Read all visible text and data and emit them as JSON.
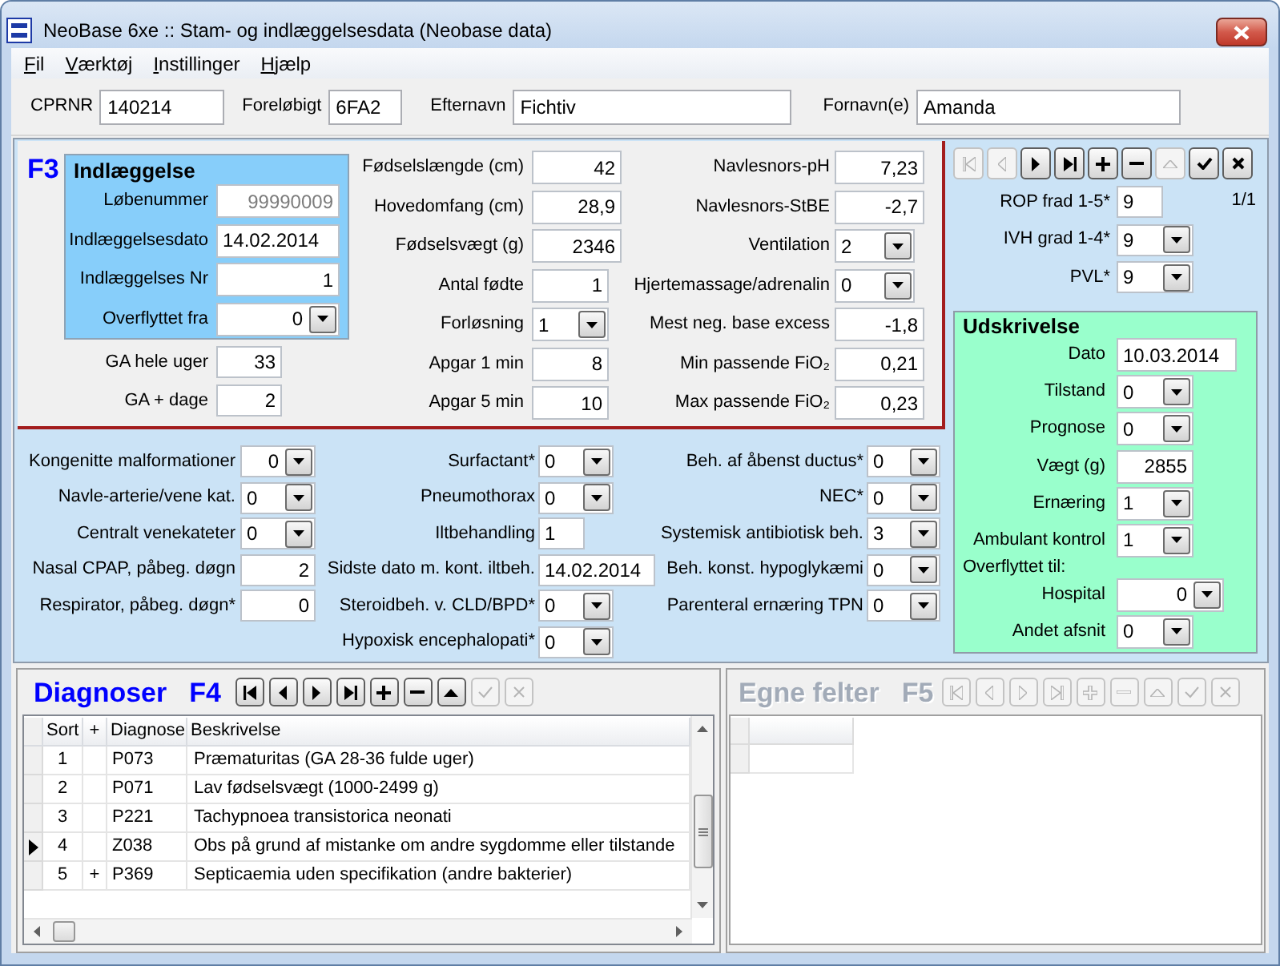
{
  "window": {
    "title": "NeoBase 6xe :: Stam- og indlæggelsesdata (Neobase data)"
  },
  "menu": [
    "Fil",
    "Værktøj",
    "Instillinger",
    "Hjælp"
  ],
  "patient_fields": [
    {
      "label": "CPRNR",
      "value": "140214"
    },
    {
      "label": "Foreløbigt",
      "value": "6FA2"
    },
    {
      "label": "Efternavn",
      "value": "Fichtiv"
    },
    {
      "label": "Fornavn(e)",
      "value": "Amanda"
    }
  ],
  "admission": {
    "hotkey": "F3",
    "indlaeggelse": {
      "title": "Indlæggelse",
      "fields": [
        {
          "label": "Løbenummer",
          "value": "99990009",
          "kind": "number",
          "disabled": true
        },
        {
          "label": "Indlæggelsesdato",
          "value": "14.02.2014",
          "kind": "text",
          "disabled": false
        },
        {
          "label": "Indlæggelses Nr",
          "value": "1",
          "kind": "number",
          "disabled": false
        },
        {
          "label": "Overflyttet fra",
          "value": "0",
          "kind": "lookup",
          "disabled": false
        }
      ]
    },
    "gestation": [
      {
        "label": "GA hele uger",
        "value": "33",
        "kind": "number"
      },
      {
        "label": "GA + dage",
        "value": "2",
        "kind": "number"
      }
    ],
    "birth": [
      {
        "label": "Fødselslængde (cm)",
        "value": "42",
        "kind": "number"
      },
      {
        "label": "Hovedomfang (cm)",
        "value": "28,9",
        "kind": "number"
      },
      {
        "label": "Fødselsvægt (g)",
        "value": "2346",
        "kind": "number"
      },
      {
        "label": "Antal fødte",
        "value": "1",
        "kind": "number"
      },
      {
        "label": "Forløsning",
        "value": "1",
        "kind": "combo"
      },
      {
        "label": "Apgar 1 min",
        "value": "8",
        "kind": "number"
      },
      {
        "label": "Apgar 5 min",
        "value": "10",
        "kind": "number"
      }
    ],
    "cord": [
      {
        "label": "Navlesnors-pH",
        "value": "7,23",
        "kind": "number"
      },
      {
        "label": "Navlesnors-StBE",
        "value": "-2,7",
        "kind": "number"
      },
      {
        "label": "Ventilation",
        "value": "2",
        "kind": "combo"
      },
      {
        "label": "Hjertemassage/adrenalin",
        "value": "0",
        "kind": "combo"
      },
      {
        "label": "Mest neg. base excess",
        "value": "-1,8",
        "kind": "number"
      },
      {
        "label": "Min passende FiO₂",
        "value": "0,21",
        "kind": "number"
      },
      {
        "label": "Max passende FiO₂",
        "value": "0,23",
        "kind": "number"
      }
    ]
  },
  "complications": {
    "column_1": [
      {
        "label": "Kongenitte malformationer",
        "value": "0",
        "kind": "lookup"
      },
      {
        "label": "Navle-arterie/vene kat.",
        "value": "0",
        "kind": "combo"
      },
      {
        "label": "Centralt venekateter",
        "value": "0",
        "kind": "combo"
      },
      {
        "label": "Nasal CPAP, påbeg. døgn",
        "value": "2",
        "kind": "number"
      },
      {
        "label": "Respirator, påbeg. døgn*",
        "value": "0",
        "kind": "number"
      }
    ],
    "column_2": [
      {
        "label": "Surfactant*",
        "value": "0",
        "kind": "combo"
      },
      {
        "label": "Pneumothorax",
        "value": "0",
        "kind": "combo"
      },
      {
        "label": "Iltbehandling",
        "value": "1",
        "kind": "text"
      },
      {
        "label": "Sidste dato m. kont. iltbeh.",
        "value": "14.02.2014",
        "kind": "text"
      },
      {
        "label": "Steroidbeh. v. CLD/BPD*",
        "value": "0",
        "kind": "combo"
      },
      {
        "label": "Hypoxisk encephalopati*",
        "value": "0",
        "kind": "combo"
      }
    ],
    "column_3": [
      {
        "label": "Beh. af åbenst ductus*",
        "value": "0",
        "kind": "combo"
      },
      {
        "label": "NEC*",
        "value": "0",
        "kind": "combo"
      },
      {
        "label": "Systemisk antibiotisk beh.",
        "value": "3",
        "kind": "combo"
      },
      {
        "label": "Beh. konst. hypoglykæmi",
        "value": "0",
        "kind": "combo"
      },
      {
        "label": "Parenteral ernæring TPN",
        "value": "0",
        "kind": "combo"
      }
    ]
  },
  "side_panel": {
    "navigator": [
      {
        "kind": "first",
        "disabled": true
      },
      {
        "kind": "prior",
        "disabled": true
      },
      {
        "kind": "next",
        "disabled": false
      },
      {
        "kind": "last",
        "disabled": false
      },
      {
        "kind": "insert",
        "disabled": false
      },
      {
        "kind": "delete",
        "disabled": false
      },
      {
        "kind": "edit",
        "disabled": true
      },
      {
        "kind": "post",
        "disabled": false
      },
      {
        "kind": "cancel",
        "disabled": false
      }
    ],
    "record_position": "1/1",
    "scores": [
      {
        "label": "ROP frad 1-5*",
        "value": "9",
        "kind": "text"
      },
      {
        "label": "IVH grad 1-4*",
        "value": "9",
        "kind": "combo"
      },
      {
        "label": "PVL*",
        "value": "9",
        "kind": "combo"
      }
    ],
    "discharge": {
      "title": "Udskrivelse",
      "fields": [
        {
          "label": "Dato",
          "value": "10.03.2014",
          "kind": "text"
        },
        {
          "label": "Tilstand",
          "value": "0",
          "kind": "combo"
        },
        {
          "label": "Prognose",
          "value": "0",
          "kind": "combo"
        },
        {
          "label": "Vægt (g)",
          "value": "2855",
          "kind": "number"
        },
        {
          "label": "Ernæring",
          "value": "1",
          "kind": "combo"
        },
        {
          "label": "Ambulant kontrol",
          "value": "1",
          "kind": "combo"
        }
      ],
      "transfer_heading": "Overflyttet til:",
      "transfer_fields": [
        {
          "label": "Hospital",
          "value": "0",
          "kind": "lookup"
        },
        {
          "label": "Andet afsnit",
          "value": "0",
          "kind": "combo"
        }
      ]
    }
  },
  "diagnoser": {
    "title": "Diagnoser",
    "hotkey": "F4",
    "disabled": false,
    "navigator": [
      {
        "kind": "first",
        "disabled": false
      },
      {
        "kind": "prior",
        "disabled": false
      },
      {
        "kind": "next",
        "disabled": false
      },
      {
        "kind": "last",
        "disabled": false
      },
      {
        "kind": "insert",
        "disabled": false
      },
      {
        "kind": "delete",
        "disabled": false
      },
      {
        "kind": "edit",
        "disabled": false
      },
      {
        "kind": "post",
        "disabled": true
      },
      {
        "kind": "cancel",
        "disabled": true
      }
    ],
    "table": {
      "columns": [
        "Sort",
        "+",
        "Diagnose",
        "Beskrivelse"
      ],
      "rows": [
        {
          "selected": false,
          "sort": "1",
          "diagnose": "P073",
          "beskrivelse": "Præmaturitas (GA 28-36 fulde uger)"
        },
        {
          "selected": false,
          "sort": "2",
          "diagnose": "P071",
          "beskrivelse": "Lav fødselsvægt (1000-2499 g)"
        },
        {
          "selected": false,
          "sort": "3",
          "diagnose": "P221",
          "beskrivelse": "Tachypnoea transistorica neonati"
        },
        {
          "selected": true,
          "sort": "4",
          "diagnose": "Z038",
          "beskrivelse": "Obs på grund af mistanke om andre sygdomme eller tilstande"
        },
        {
          "selected": false,
          "sort": "5",
          "plus": "+",
          "diagnose": "P369",
          "beskrivelse": "Septicaemia uden specifikation (andre bakterier)"
        }
      ]
    }
  },
  "egne_felter": {
    "title": "Egne felter",
    "hotkey": "F5",
    "disabled": true,
    "navigator": [
      {
        "kind": "first",
        "disabled": true
      },
      {
        "kind": "prior",
        "disabled": true
      },
      {
        "kind": "next",
        "disabled": true
      },
      {
        "kind": "last",
        "disabled": true
      },
      {
        "kind": "insert",
        "disabled": true
      },
      {
        "kind": "delete",
        "disabled": true
      },
      {
        "kind": "edit",
        "disabled": true
      },
      {
        "kind": "post",
        "disabled": true
      },
      {
        "kind": "cancel",
        "disabled": true
      }
    ]
  }
}
